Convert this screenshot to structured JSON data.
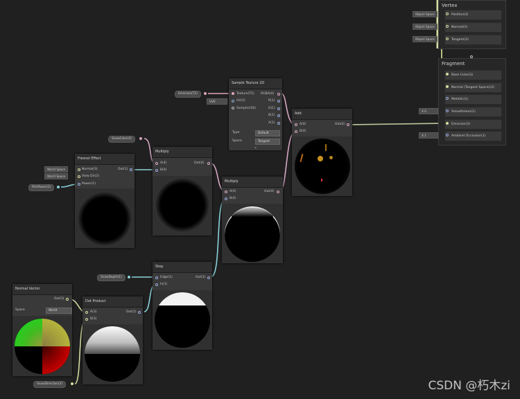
{
  "vertex": {
    "title": "Vertex",
    "rows": [
      {
        "label": "Position(3)",
        "tag": "Object Space"
      },
      {
        "label": "Normal(3)",
        "tag": "Object Space"
      },
      {
        "label": "Tangent(3)",
        "tag": "Object Space"
      }
    ]
  },
  "fragment": {
    "title": "Fragment",
    "rows": [
      {
        "label": "Base Color(3)",
        "tag": ""
      },
      {
        "label": "Normal (Tangent Space)(3)",
        "tag": ""
      },
      {
        "label": "Metallic(1)",
        "tag": ""
      },
      {
        "label": "Smoothness(1)",
        "tag": "X  0"
      },
      {
        "label": "Emission(3)",
        "tag": ""
      },
      {
        "label": "Ambient Occlusion(1)",
        "tag": "X  1"
      }
    ]
  },
  "sample_texture": {
    "title": "Sample Texture 2D",
    "inputs": [
      "Texture(T2)",
      "UV(2)",
      "Sampler(SS)"
    ],
    "outputs": [
      "RGBA(4)",
      "R(1)",
      "G(1)",
      "B(1)",
      "A(1)"
    ],
    "uv_value": "UV0",
    "type_label": "Type",
    "type_value": "Default",
    "space_label": "Space",
    "space_value": "Tangent",
    "collapse": "⌄"
  },
  "emission_prop": "Emission(T2)",
  "add_node": {
    "title": "Add",
    "inputs": [
      "A(4)",
      "B(4)"
    ],
    "output": "Out(4)"
  },
  "snowcolor_prop": "SnowColor(4)",
  "multiply1": {
    "title": "Multiply",
    "inputs": [
      "A(4)",
      "B(4)"
    ],
    "output": "Out(4)"
  },
  "fresnel": {
    "title": "Fresnel Effect",
    "inputs": [
      "Normal(3)",
      "View Dir(3)",
      "Power(1)"
    ],
    "tags": [
      "World Space",
      "World Space"
    ],
    "output": "Out(1)"
  },
  "rimpower_prop": "RimPower(1)",
  "multiply2": {
    "title": "Multiply",
    "inputs": [
      "A(4)",
      "B(4)"
    ],
    "output": "Out(4)"
  },
  "step": {
    "title": "Step",
    "inputs": [
      "Edge(1)",
      "In(1)"
    ],
    "output": "Out(1)"
  },
  "snowdepth_prop": "SnowDepth(1)",
  "normal_vector": {
    "title": "Normal Vector",
    "output": "Out(3)",
    "space_label": "Space",
    "space_value": "World"
  },
  "dot_product": {
    "title": "Dot Product",
    "inputs": [
      "A(3)",
      "B(3)"
    ],
    "output": "Out(1)"
  },
  "snowdirection_prop": "SnowDirection(3)",
  "watermark": "CSDN @朽木zi",
  "colors": {
    "background": "#202020",
    "node": "#393939",
    "wire_vec3": "#d6dba1",
    "wire_vec1": "#8ad4dc",
    "wire_vec4": "#d7a7c4"
  }
}
